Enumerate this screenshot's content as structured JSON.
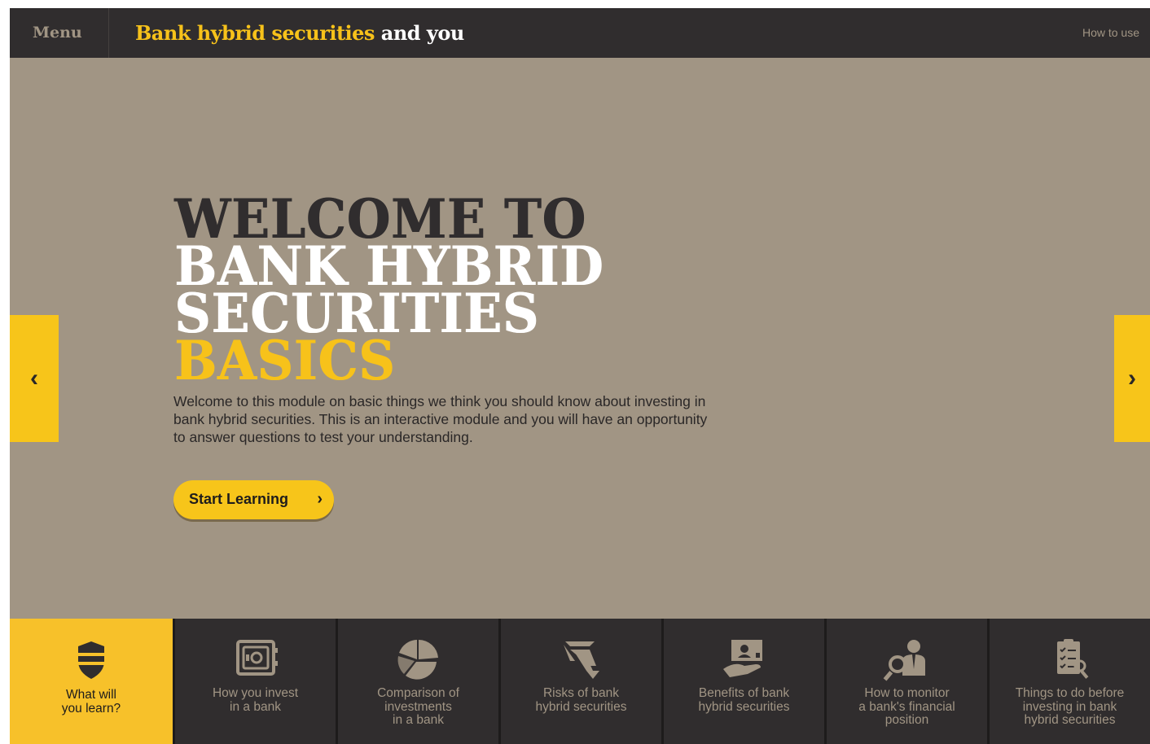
{
  "header": {
    "menu_label": "Menu",
    "title_part1": "Bank hybrid securities",
    "title_part2": "and you",
    "how_to_use": "How to use"
  },
  "hero": {
    "line1": "WELCOME TO",
    "line2": "BANK HYBRID",
    "line3": "SECURITIES",
    "line4": "BASICS",
    "intro_line1": "Welcome to this module on basic things we think you should know about investing in",
    "intro_line2": "bank hybrid securities. This is an interactive module and you will have an opportunity",
    "intro_line3": "to answer questions to test your understanding.",
    "start_button": "Start Learning",
    "start_chevron": "›"
  },
  "arrows": {
    "prev": "‹",
    "next": "›"
  },
  "bottom_nav": [
    {
      "line1": "What will",
      "line2": "you learn?",
      "line3": "",
      "icon": "shield-icon",
      "active": true
    },
    {
      "line1": "How you invest",
      "line2": "in a bank",
      "line3": "",
      "icon": "safe-icon",
      "active": false
    },
    {
      "line1": "Comparison of",
      "line2": "investments",
      "line3": "in a bank",
      "icon": "pie-chart-icon",
      "active": false
    },
    {
      "line1": "Risks of bank",
      "line2": "hybrid securities",
      "line3": "",
      "icon": "risk-arrows-icon",
      "active": false
    },
    {
      "line1": "Benefits of bank",
      "line2": "hybrid securities",
      "line3": "",
      "icon": "money-hand-icon",
      "active": false
    },
    {
      "line1": "How to monitor",
      "line2": "a bank's financial",
      "line3": "position",
      "icon": "magnifier-person-icon",
      "active": false
    },
    {
      "line1": "Things to do before",
      "line2": "investing in bank",
      "line3": "hybrid securities",
      "icon": "checklist-icon",
      "active": false
    }
  ],
  "colors": {
    "accent": "#f7c51a",
    "dark": "#302d2e",
    "background": "#a19584"
  }
}
